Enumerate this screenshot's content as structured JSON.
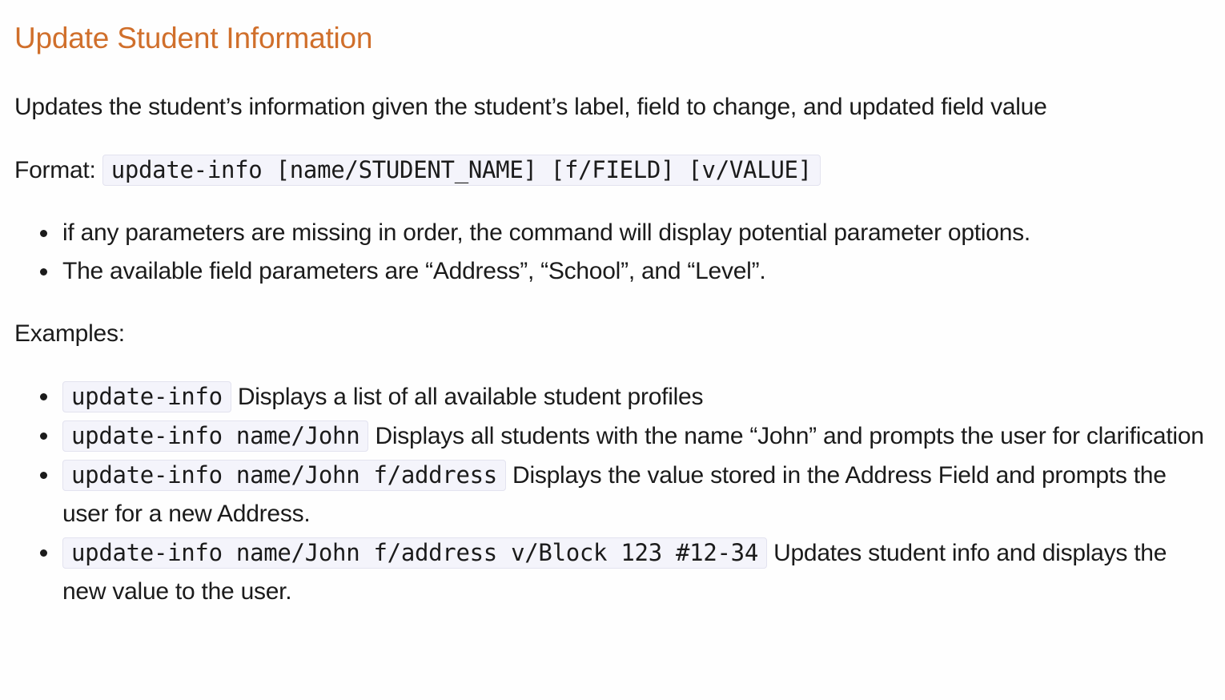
{
  "heading": "Update Student Information",
  "description": "Updates the student’s information given the student’s label, field to change, and updated field value",
  "format": {
    "label": "Format:",
    "command": "update-info [name/STUDENT_NAME] [f/FIELD] [v/VALUE]"
  },
  "notes": [
    "if any parameters are missing in order, the command will display potential parameter options.",
    "The available field parameters are “Address”, “School”, and “Level”."
  ],
  "examples_label": "Examples:",
  "examples": [
    {
      "code": "update-info",
      "text": " Displays a list of all available student profiles"
    },
    {
      "code": "update-info name/John",
      "text": " Displays all students with the name “John” and prompts the user for clarification"
    },
    {
      "code": "update-info name/John f/address",
      "text": " Displays the value stored in the Address Field and prompts the user for a new Address."
    },
    {
      "code": "update-info name/John f/address v/Block 123 #12-34",
      "text": " Updates student info and displays the new value to the user."
    }
  ]
}
